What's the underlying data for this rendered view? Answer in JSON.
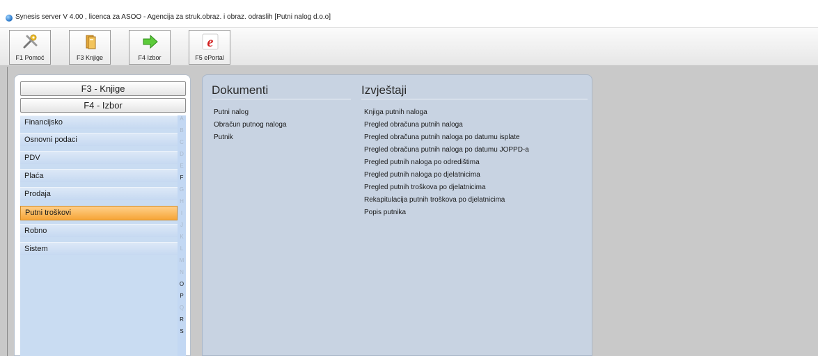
{
  "window": {
    "title": "Synesis server V 4.00 , licenca za ASOO - Agencija za struk.obraz. i obraz. odraslih   [Putni nalog d.o.o]"
  },
  "toolbar": {
    "buttons": [
      {
        "label": "F1 Pomoć",
        "icon": "help-tools-icon"
      },
      {
        "label": "F3 Knjige",
        "icon": "books-folder-icon"
      },
      {
        "label": "F4 Izbor",
        "icon": "green-arrow-icon"
      },
      {
        "label": "F5 ePortal",
        "icon": "eportal-e-icon"
      }
    ]
  },
  "left": {
    "knjige_button": "F3 - Knjige",
    "izbor_button": "F4 - Izbor",
    "items": [
      {
        "label": "Financijsko"
      },
      {
        "label": "Osnovni podaci"
      },
      {
        "label": "PDV"
      },
      {
        "label": "Plaća"
      },
      {
        "label": "Prodaja"
      },
      {
        "label": "Putni troškovi",
        "active": true
      },
      {
        "label": "Robno"
      },
      {
        "label": "Sistem"
      }
    ],
    "letters": [
      "A",
      "B",
      "C",
      "D",
      "E",
      "F",
      "G",
      "H",
      "I",
      "J",
      "K",
      "L",
      "M",
      "N",
      "O",
      "P",
      "Q",
      "R",
      "S"
    ],
    "active_letters": [
      "F",
      "O",
      "P",
      "R",
      "S"
    ]
  },
  "main": {
    "dokumenti_title": "Dokumenti",
    "izvjestaji_title": "Izvještaji",
    "dokumenti": [
      "Putni nalog",
      "Obračun putnog naloga",
      "Putnik"
    ],
    "izvjestaji": [
      "Knjiga putnih naloga",
      "Pregled obračuna putnih naloga",
      "Pregled obračuna putnih naloga po datumu isplate",
      "Pregled obračuna putnih naloga po datumu JOPPD-a",
      "Pregled putnih naloga po odredištima",
      "Pregled putnih naloga po djelatnicima",
      "Pregled putnih troškova po djelatnicima",
      "Rekapitulacija putnih troškova po djelatnicima",
      "Popis putnika"
    ]
  },
  "colors": {
    "active_item": "#f6a537",
    "nav_background": "#c9dcf2",
    "main_panel": "#c8d3e2"
  }
}
